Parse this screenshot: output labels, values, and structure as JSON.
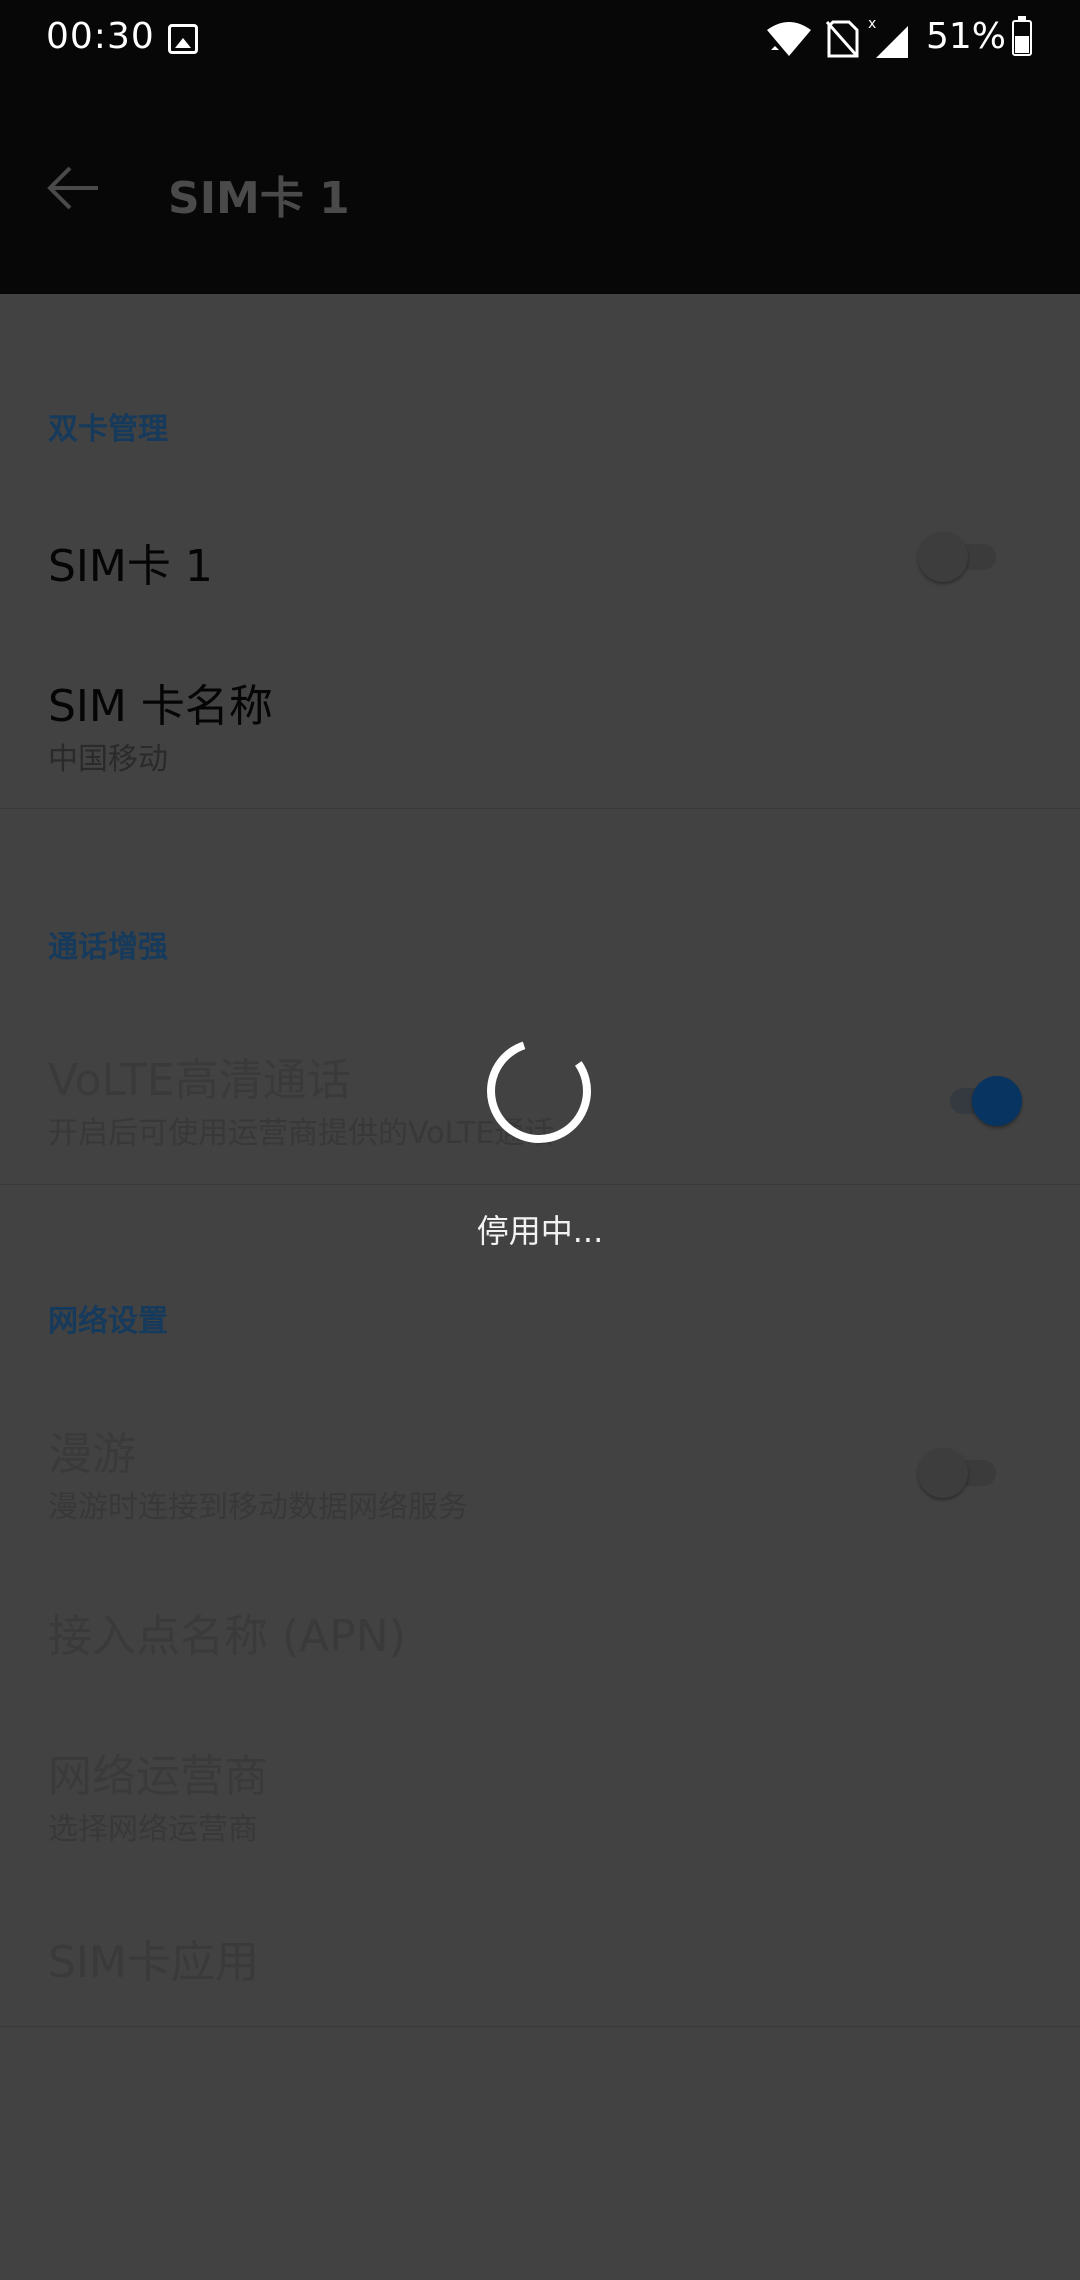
{
  "status_bar": {
    "time": "00:30",
    "battery_percent": "51%",
    "icons": [
      "image-icon",
      "wifi-icon",
      "no-sim-icon",
      "signal-icon",
      "battery-icon"
    ]
  },
  "app_bar": {
    "title": "SIM卡 1",
    "back_icon": "arrow-left-icon"
  },
  "sections": {
    "dual_sim": {
      "header": "双卡管理",
      "sim1": {
        "title": "SIM卡 1",
        "enabled": false
      },
      "sim_name": {
        "title": "SIM 卡名称",
        "subtitle": "中国移动"
      }
    },
    "call_enhance": {
      "header": "通话增强",
      "volte": {
        "title": "VoLTE高清通话",
        "subtitle": "开启后可使用运营商提供的VoLTE通话",
        "enabled": true
      }
    },
    "network": {
      "header": "网络设置",
      "roaming": {
        "title": "漫游",
        "subtitle": "漫游时连接到移动数据网络服务",
        "enabled": false
      },
      "apn": {
        "title": "接入点名称 (APN)"
      },
      "operator": {
        "title": "网络运营商",
        "subtitle": "选择网络运营商"
      },
      "sim_apps": {
        "title": "SIM卡应用"
      }
    }
  },
  "loading": {
    "text": "停用中..."
  },
  "colors": {
    "scrim_background": "#424242",
    "accent_dimmed": "#163a5c",
    "toggle_on_dimmed": "#083462"
  }
}
